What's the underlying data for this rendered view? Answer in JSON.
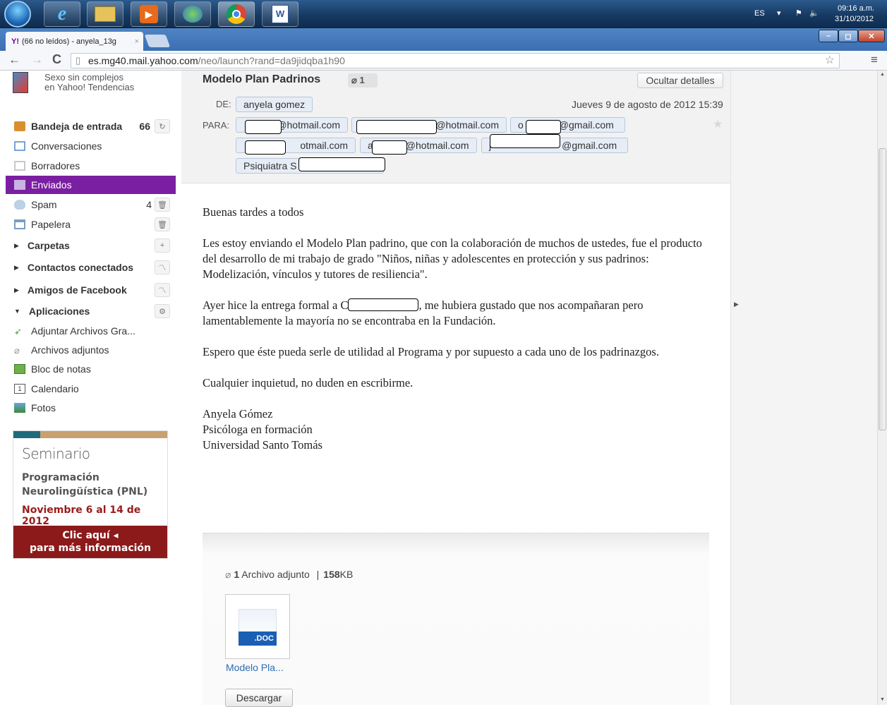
{
  "window": {
    "tab_title": "(66 no leídos) - anyela_13g",
    "tab_close": "×",
    "url_host": "es.mg40.mail.yahoo.com",
    "url_path": "/neo/launch?rand=da9jidqba1h90"
  },
  "taskbar": {
    "lang": "ES",
    "time": "09:16 a.m.",
    "date": "31/10/2012"
  },
  "sidebar": {
    "promo_line1": "Sexo sin complejos",
    "promo_line2": "en Yahoo! Tendencias",
    "items": [
      {
        "label": "Bandeja de entrada",
        "count": "66"
      },
      {
        "label": "Conversaciones"
      },
      {
        "label": "Borradores"
      },
      {
        "label": "Enviados"
      },
      {
        "label": "Spam",
        "count": "4"
      },
      {
        "label": "Papelera"
      },
      {
        "label": "Carpetas"
      },
      {
        "label": "Contactos conectados"
      },
      {
        "label": "Amigos de Facebook"
      },
      {
        "label": "Aplicaciones"
      },
      {
        "label": "Adjuntar Archivos Gra..."
      },
      {
        "label": "Archivos adjuntos"
      },
      {
        "label": "Bloc de notas"
      },
      {
        "label": "Calendario"
      },
      {
        "label": "Fotos"
      }
    ],
    "ad": {
      "title": "Seminario",
      "line1": "Programación",
      "line2": "Neurolingüística (PNL)",
      "dates": "Noviembre 6 al 14 de 2012",
      "cta1": "Clic aquí ◂",
      "cta2": "para más información"
    }
  },
  "message": {
    "subject": "Modelo Plan Padrinos",
    "attach_count": "1",
    "hide_details": "Ocultar detalles",
    "from_label": "DE:",
    "from": "anyela gomez",
    "date": "Jueves 9 de agosto de 2012 15:39",
    "to_label": "PARA:",
    "to": [
      "@hotmail.com",
      "@hotmail.com",
      "o",
      "@gmail.com",
      "otmail.com",
      "a",
      "@hotmail.com",
      "j",
      "@gmail.com",
      "Psiquiatra S"
    ],
    "body": [
      "Buenas tardes a todos",
      "Les estoy enviando el Modelo Plan padrino, que con la colaboración de muchos de ustedes, fue el producto del desarrollo de mi trabajo de grado \"Niños, niñas y adolescentes en protección y sus padrinos: Modelización, vínculos y tutores de resiliencia\".",
      "Ayer hice la entrega formal a C",
      ", me hubiera gustado que nos acompañaran pero lamentablemente la mayoría no se encontraba en la Fundación.",
      "Espero que éste pueda serle de utilidad al Programa y por supuesto a cada uno de los padrinazgos.",
      "Cualquier inquietud, no duden en escribirme.",
      "Anyela Gómez",
      "Psicóloga en formación",
      "Universidad Santo Tomás"
    ],
    "attachments_count": "1",
    "attachments_label": "Archivo adjunto",
    "attachments_size_num": "158",
    "attachments_size_unit": "KB",
    "file_type": ".DOC",
    "file_name": "Modelo Pla...",
    "download": "Descargar"
  }
}
